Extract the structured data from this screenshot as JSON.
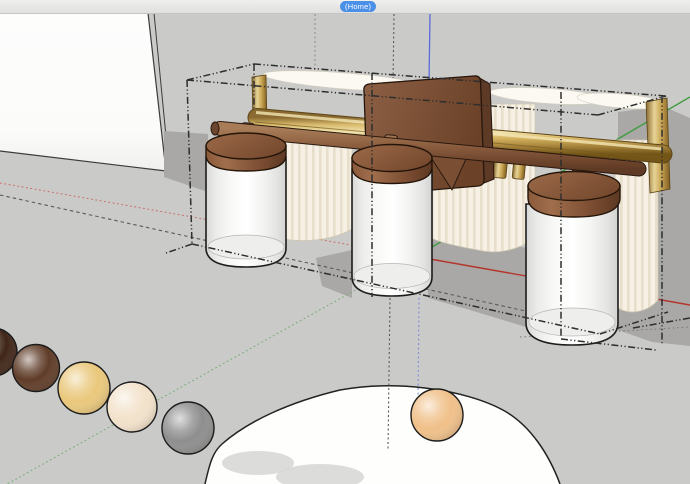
{
  "app": {
    "toolbar": {
      "home_tab_label": "(Home)"
    }
  },
  "viewport": {
    "type": "3d-modeling-viewport",
    "background_color": "#CACAC9",
    "cast_shadow_color": "#A9A8A6",
    "axes": {
      "red_axis_color": "#B5352C",
      "green_axis_color": "#3D9B3D",
      "blue_axis_color": "#5A6BD8"
    },
    "selection": {
      "box_line_color": "#2E2E2E",
      "line_style": "dash-dot-dot"
    },
    "model": {
      "fixture": {
        "label": "3-light vanity fixture",
        "brass_bar_color": "#C9A556",
        "rod_color": "#8A5C3E",
        "cap_color": "#8A5A3C",
        "glass_color": "#F7F7F5",
        "backplate_color": "#7C5138",
        "pleated_shade_color": "#F4EFE2"
      },
      "wall_panel_color": "#FCFCFC",
      "table_color": "#FEFEFD",
      "material_spheres": [
        {
          "label": "espresso-sphere",
          "color": "#3F2517"
        },
        {
          "label": "brown-sphere",
          "color": "#5F3C28"
        },
        {
          "label": "gold-sphere",
          "color": "#EAC87C"
        },
        {
          "label": "cream-sphere",
          "color": "#F2E2CB"
        },
        {
          "label": "gray-sphere",
          "color": "#8E8E8E"
        },
        {
          "label": "table-gold-sphere",
          "color": "#F0C089"
        }
      ]
    }
  }
}
